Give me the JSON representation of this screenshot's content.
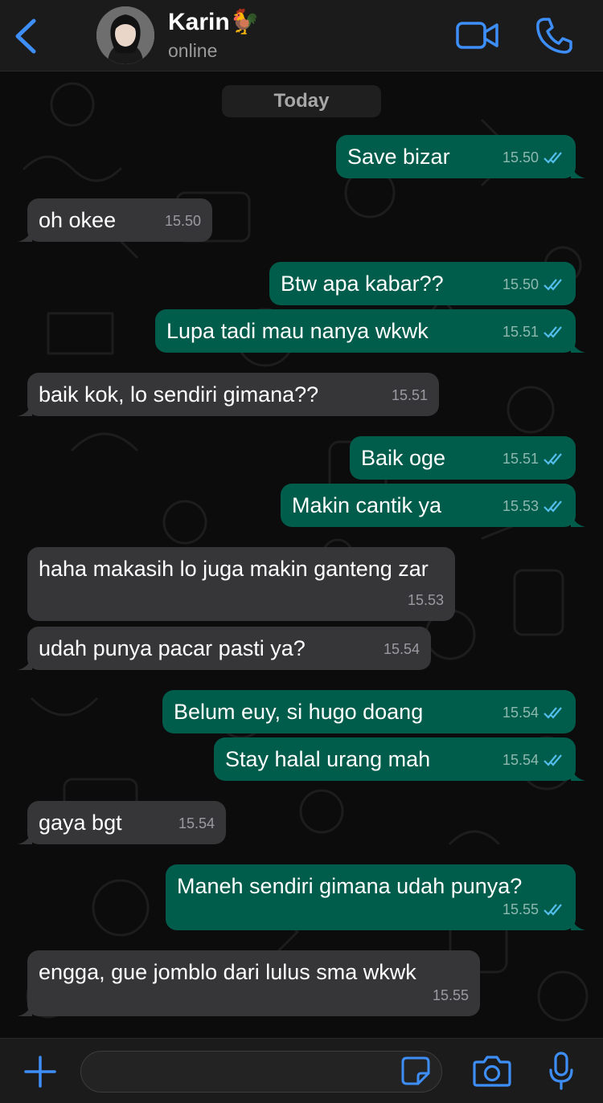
{
  "header": {
    "contact_name": "Karin🐓",
    "status": "online"
  },
  "chat": {
    "date_label": "Today",
    "messages": [
      {
        "dir": "out",
        "text": "Save bizar",
        "time": "15.50",
        "read": true
      },
      {
        "dir": "in",
        "text": "oh okee",
        "time": "15.50"
      },
      {
        "dir": "out",
        "text": "Btw apa kabar??",
        "time": "15.50",
        "read": true
      },
      {
        "dir": "out",
        "text": "Lupa tadi mau nanya wkwk",
        "time": "15.51",
        "read": true
      },
      {
        "dir": "in",
        "text": "baik kok, lo sendiri gimana??",
        "time": "15.51"
      },
      {
        "dir": "out",
        "text": "Baik oge",
        "time": "15.51",
        "read": true
      },
      {
        "dir": "out",
        "text": "Makin cantik ya",
        "time": "15.53",
        "read": true
      },
      {
        "dir": "in",
        "text": "haha makasih lo juga makin ganteng zar",
        "time": "15.53"
      },
      {
        "dir": "in",
        "text": "udah punya pacar pasti ya?",
        "time": "15.54"
      },
      {
        "dir": "out",
        "text": "Belum euy, si hugo doang",
        "time": "15.54",
        "read": true
      },
      {
        "dir": "out",
        "text": "Stay halal urang mah",
        "time": "15.54",
        "read": true
      },
      {
        "dir": "in",
        "text": "gaya bgt",
        "time": "15.54"
      },
      {
        "dir": "out",
        "text": "Maneh sendiri gimana udah punya?",
        "time": "15.55",
        "read": true
      },
      {
        "dir": "in",
        "text": "engga, gue jomblo dari lulus sma wkwk",
        "time": "15.55"
      }
    ]
  },
  "composer": {
    "input_value": ""
  },
  "icons": {
    "back": "chevron-left-icon",
    "video": "video-camera-icon",
    "call": "phone-icon",
    "plus": "plus-icon",
    "sticker": "sticker-icon",
    "camera": "camera-icon",
    "mic": "microphone-icon",
    "read_receipt": "double-check-icon"
  },
  "colors": {
    "accent": "#3e8ef7",
    "outgoing_bubble": "#005c4b",
    "incoming_bubble": "#363638",
    "read_tick": "#53bdeb"
  }
}
